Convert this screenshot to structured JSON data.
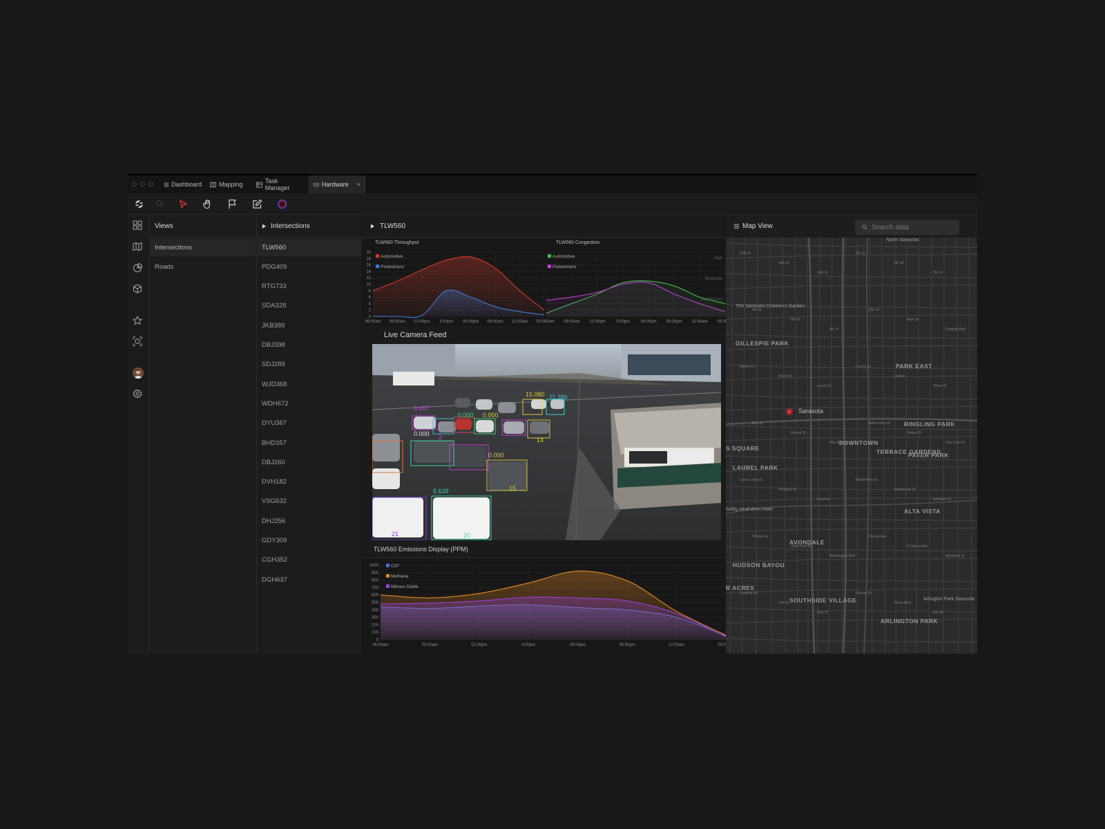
{
  "tabs": [
    {
      "label": "Dashboard",
      "icon": "grid-icon"
    },
    {
      "label": "Mapping",
      "icon": "map-icon"
    },
    {
      "label": "Task Manager",
      "icon": "table-icon"
    },
    {
      "label": "Hardware",
      "icon": "hardware-icon",
      "active": true,
      "close": "×"
    }
  ],
  "toolbar": {
    "tools": [
      "search-icon",
      "pointer-icon",
      "hand-icon",
      "flag-icon",
      "edit-icon",
      "record-icon"
    ],
    "accent": "#e53030"
  },
  "views": {
    "title": "Views",
    "items": [
      "Intersections",
      "Roads"
    ],
    "selected": 0
  },
  "intersections": {
    "title": "Intersections",
    "items": [
      "TLW560",
      "PDG409",
      "RTG733",
      "SDA328",
      "JKB389",
      "DBJ398",
      "SDJ289",
      "WJD368",
      "WDH672",
      "DYU367",
      "BHD357",
      "DBJ260",
      "DVH182",
      "VSG632",
      "DHJ256",
      "GDY309",
      "CGH352",
      "DGH637"
    ],
    "selected": 0
  },
  "detail": {
    "title": "TLW560",
    "camera_title": "Live Camera Feed",
    "camera_labels": [
      "8.487",
      "0.000",
      "15.080",
      "11.386",
      "0.000",
      "5.639",
      "21",
      "20",
      "15",
      "14",
      "2",
      "0.000",
      "0.000"
    ]
  },
  "map": {
    "title": "Map View",
    "search_placeholder": "Search data",
    "marker_label": "Sarasota",
    "neighborhoods": [
      "GILLESPIE PARK",
      "PARK EAST",
      "RINGLING PARK",
      "DOWNTOWN",
      "TERRACE GARDENS",
      "PAVER PARK",
      "LAUREL PARK",
      "ALTA VISTA",
      "AVONDALE",
      "HUDSON BAYOU",
      "SOUTHSIDE VILLAGE",
      "ARLINGTON PARK",
      "S SQUARE",
      "R ACRES",
      "North Sarasota",
      "The Sarasota Children's Garden",
      "Selby nical dens town",
      "Arlington Park Sarasota"
    ],
    "streets": [
      "12th St",
      "11th St",
      "10th St",
      "9th St",
      "8th St",
      "7th St",
      "6th St",
      "5th St",
      "4th St",
      "13th St",
      "Main St",
      "Ringling Blvd",
      "Adams Ln",
      "Morrill St",
      "Laurel St",
      "Cherry Ln",
      "Oak St",
      "Wood St",
      "Bay St",
      "Mound St",
      "Alta Vista St",
      "Bahia Vista St",
      "Hatton St",
      "Tami Sola St",
      "Lorna Linda St",
      "Prospect St",
      "Floyd St",
      "Waldemere St",
      "Hawthorne St",
      "Arlington St",
      "Hillview St",
      "Hyde Park St",
      "Washington Blvd",
      "Orange Ave",
      "S Osprey Ave",
      "Aspinwall St",
      "Fruitville Rd",
      "Golf St",
      "Pine Pl",
      "Pelican Dr",
      "Davis Blvd",
      "Elm St"
    ]
  },
  "chart_data": [
    {
      "type": "area",
      "title": "TLW560 Throughput",
      "x": [
        "06:00am",
        "09:00am",
        "12:00pm",
        "3:00pm",
        "06:00pm",
        "09:00pm",
        "12:00am",
        "03:00am"
      ],
      "ylim": [
        0,
        20
      ],
      "yticks": [
        0,
        2,
        4,
        6,
        8,
        10,
        12,
        14,
        16,
        18,
        20
      ],
      "series": [
        {
          "name": "Automotive",
          "color": "#d33a2c",
          "values": [
            8,
            11,
            14.5,
            17.5,
            18.5,
            15,
            8,
            2
          ]
        },
        {
          "name": "Pedestrians",
          "color": "#3c7bd8",
          "values": [
            0,
            0,
            0.3,
            8,
            6,
            3,
            1.5,
            0.5
          ]
        }
      ]
    },
    {
      "type": "line",
      "title": "TLW560 Congestion",
      "x": [
        "06:00am",
        "09:00am",
        "12:00pm",
        "3:00pm",
        "06:00pm",
        "09:00pm",
        "12:00am",
        "03:00am"
      ],
      "ylim": [
        0,
        20
      ],
      "yticks": [
        0,
        2,
        4,
        6,
        8,
        10,
        12,
        14,
        16,
        18,
        20
      ],
      "annotations": [
        "High",
        "Moderate",
        "Satisfactory"
      ],
      "series": [
        {
          "name": "Automotive",
          "color": "#3fbf4a",
          "values": [
            1,
            4,
            7,
            10.5,
            11,
            9.5,
            6,
            4
          ]
        },
        {
          "name": "Pedestrians",
          "color": "#c43fd8",
          "values": [
            5,
            6,
            7.5,
            10,
            10.5,
            7,
            4,
            1.5
          ]
        }
      ]
    },
    {
      "type": "area",
      "title": "TLW560 Emissions Display (PPM)",
      "x": [
        "06:00am",
        "09:00am",
        "12:00pm",
        "3:00pm",
        "06:00pm",
        "09:00pm",
        "12:00am",
        "03:00am"
      ],
      "ylim": [
        0,
        1000
      ],
      "yticks": [
        0,
        100,
        200,
        300,
        400,
        500,
        600,
        700,
        800,
        900,
        1000
      ],
      "series": [
        {
          "name": "CO²",
          "color": "#4d6fd8",
          "values": [
            440,
            420,
            450,
            470,
            430,
            400,
            300,
            50
          ]
        },
        {
          "name": "Methane",
          "color": "#e38a24",
          "values": [
            600,
            560,
            620,
            760,
            920,
            790,
            380,
            60
          ]
        },
        {
          "name": "Nitrous Oxide",
          "color": "#9a3fd8",
          "values": [
            480,
            490,
            520,
            570,
            560,
            520,
            350,
            40
          ]
        }
      ]
    }
  ]
}
